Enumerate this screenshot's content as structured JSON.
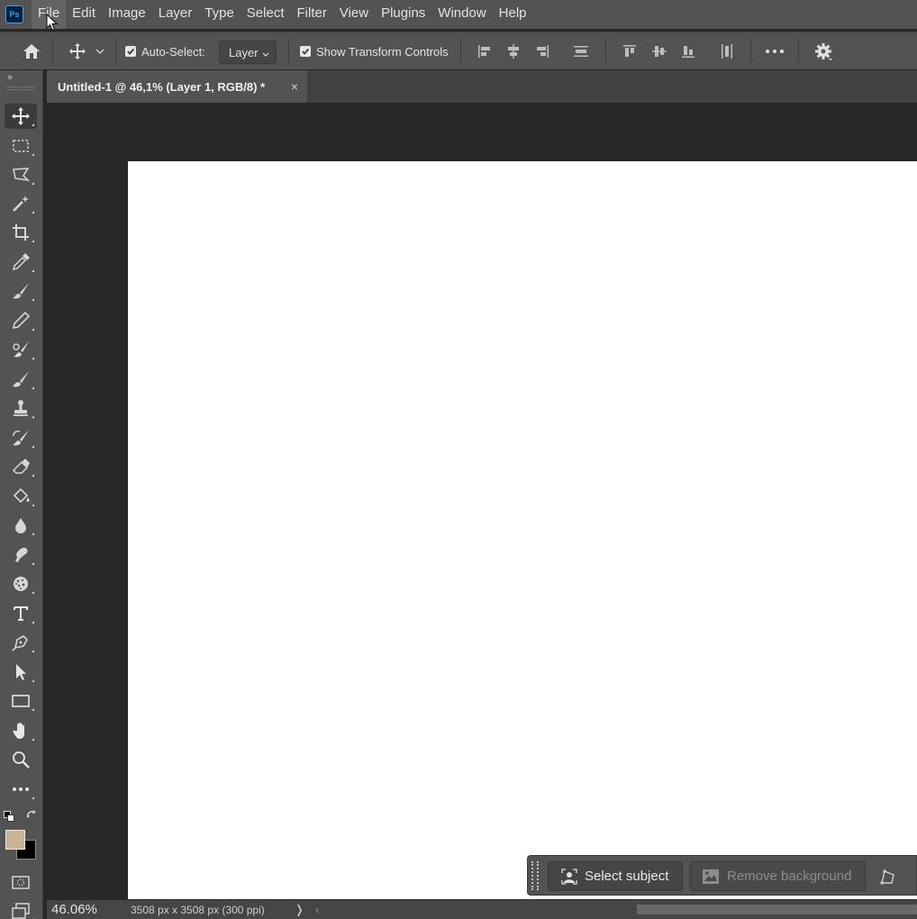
{
  "app": {
    "logo": "Ps"
  },
  "menu": [
    "File",
    "Edit",
    "Image",
    "Layer",
    "Type",
    "Select",
    "Filter",
    "View",
    "Plugins",
    "Window",
    "Help"
  ],
  "options": {
    "auto_select_label": "Auto-Select:",
    "auto_select_checked": true,
    "auto_select_target": "Layer",
    "show_transform_label": "Show Transform Controls",
    "show_transform_checked": true,
    "more_label": "•••"
  },
  "document": {
    "tab_title": "Untitled-1 @ 46,1% (Layer 1, RGB/8) *",
    "close_glyph": "×"
  },
  "toolbar": {
    "collapse_glyph": "»",
    "tools": [
      "move-tool",
      "rectangular-marquee-tool",
      "polygonal-lasso-tool",
      "magic-wand-tool",
      "crop-tool",
      "eyedropper-tool",
      "brush-tool",
      "pencil-tool",
      "color-replacement-tool",
      "mixer-brush-tool",
      "clone-stamp-tool",
      "history-brush-tool",
      "eraser-tool",
      "paint-bucket-tool",
      "blur-tool",
      "smudge-tool",
      "sponge-tool",
      "type-tool",
      "pen-tool",
      "path-selection-tool",
      "rectangle-tool",
      "hand-tool",
      "zoom-tool",
      "edit-toolbar"
    ],
    "foreground_color": "#c8b494",
    "background_color": "#000000"
  },
  "taskbar": {
    "select_subject": "Select subject",
    "remove_background": "Remove background"
  },
  "status": {
    "zoom": "46.06%",
    "doc_info": "3508 px x 3508 px (300 ppi)",
    "arrow": "❭",
    "scroll_left": "‹"
  },
  "colors": {
    "canvas": "#ffffff",
    "pasteboard": "#282828",
    "ui_panel": "#535353",
    "accent": "#31a8ff"
  }
}
